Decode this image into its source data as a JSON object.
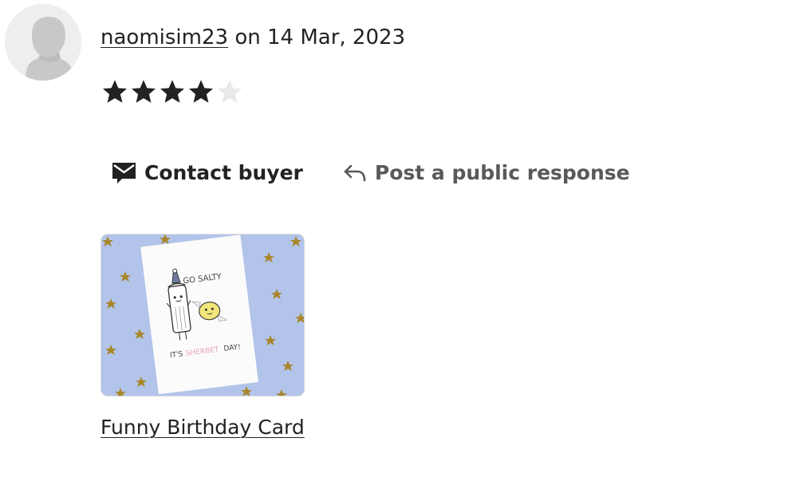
{
  "review": {
    "username": "naomisim23",
    "date_text": "on 14 Mar, 2023",
    "rating": 4,
    "rating_max": 5
  },
  "actions": {
    "contact_label": "Contact buyer",
    "respond_label": "Post a public response"
  },
  "listing": {
    "title": "Funny Birthday Card",
    "card_text_top": "GO SALTY",
    "card_text_bottom_1": "IT'S",
    "card_text_bottom_2": "SHERBET",
    "card_text_bottom_3": "DAY!"
  },
  "colors": {
    "filled_star": "#222222",
    "empty_star": "#e9e9e9",
    "thumb_background": "#b3c4ea",
    "thumb_star": "#a8862a"
  },
  "icons": {
    "avatar": "default-user-silhouette",
    "contact": "envelope-icon",
    "respond": "reply-arrow-icon",
    "rating": "star-icon"
  }
}
